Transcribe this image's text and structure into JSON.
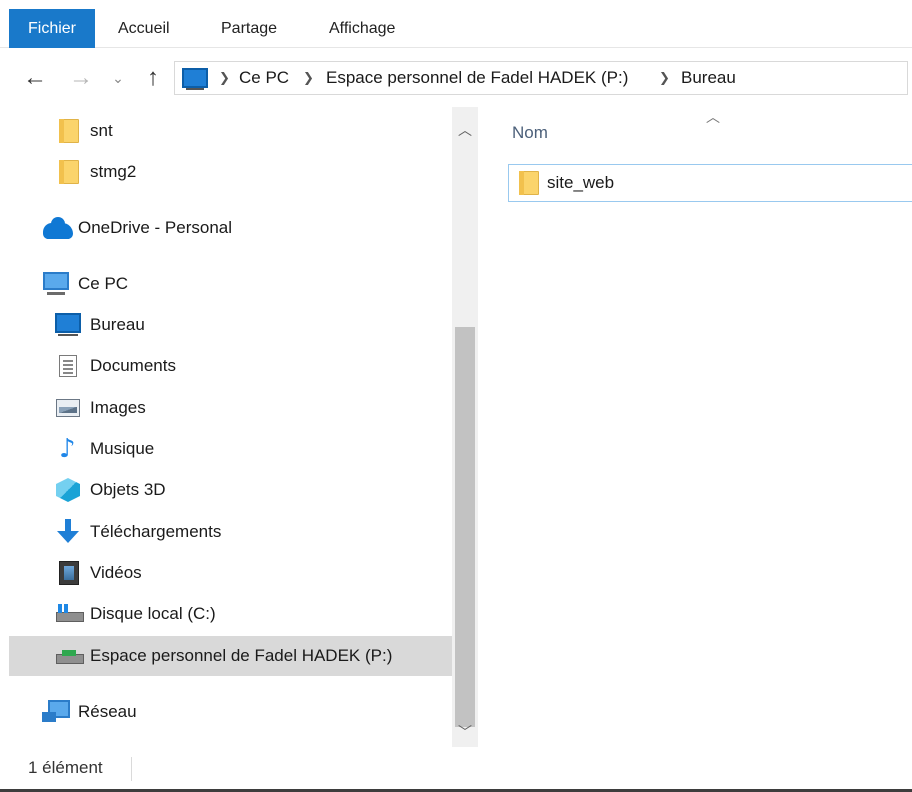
{
  "ribbon": {
    "tabs": [
      "Fichier",
      "Accueil",
      "Partage",
      "Affichage"
    ],
    "active_tab_color": "#1979ca"
  },
  "navigation": {
    "back_icon": "arrow-left-icon",
    "forward_icon": "arrow-right-icon",
    "recent_icon": "chevron-down-icon",
    "up_icon": "arrow-up-icon",
    "breadcrumb": [
      "Ce PC",
      "Espace personnel de Fadel HADEK (P:)",
      "Bureau"
    ]
  },
  "sidebar": {
    "items": [
      {
        "label": "snt",
        "icon": "folder-icon"
      },
      {
        "label": "stmg2",
        "icon": "folder-icon"
      },
      {
        "label": "OneDrive - Personal",
        "icon": "onedrive-icon"
      },
      {
        "label": "Ce PC",
        "icon": "computer-icon"
      },
      {
        "label": "Bureau",
        "icon": "desktop-icon"
      },
      {
        "label": "Documents",
        "icon": "documents-icon"
      },
      {
        "label": "Images",
        "icon": "images-icon"
      },
      {
        "label": "Musique",
        "icon": "music-icon"
      },
      {
        "label": "Objets 3D",
        "icon": "3d-objects-icon"
      },
      {
        "label": "Téléchargements",
        "icon": "downloads-icon"
      },
      {
        "label": "Vidéos",
        "icon": "videos-icon"
      },
      {
        "label": "Disque local (C:)",
        "icon": "local-disk-icon"
      },
      {
        "label": "Espace personnel de Fadel HADEK (P:)",
        "icon": "network-drive-icon",
        "selected": true
      },
      {
        "label": "Réseau",
        "icon": "network-icon"
      }
    ]
  },
  "content": {
    "column_header": "Nom",
    "sort_icon": "chevron-up-icon",
    "files": [
      {
        "name": "site_web",
        "icon": "folder-icon"
      }
    ]
  },
  "status": {
    "item_count": "1 élément"
  }
}
